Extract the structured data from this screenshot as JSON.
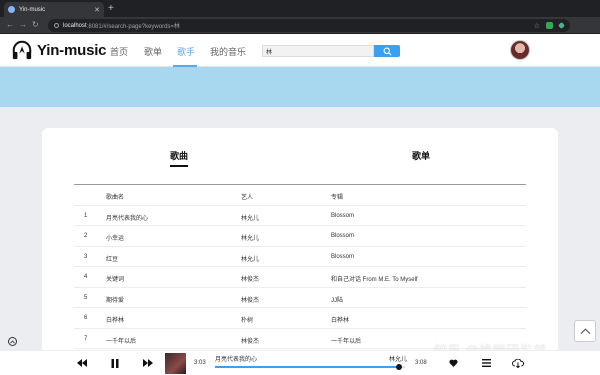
{
  "browser": {
    "tab_title": "Yin-music",
    "url_host": "localhost",
    "url_path": ":8081/#/search-page?keywords=林"
  },
  "app": {
    "logo_text": "Yin-music",
    "nav": [
      {
        "label": "首页",
        "active": false
      },
      {
        "label": "歌单",
        "active": false
      },
      {
        "label": "歌手",
        "active": true
      },
      {
        "label": "我的音乐",
        "active": false
      }
    ],
    "search_value": "林",
    "accent_color": "#3ba0f0"
  },
  "results": {
    "tabs": [
      "歌曲",
      "歌单"
    ],
    "active_tab": "歌曲",
    "columns": [
      "歌曲名",
      "艺人",
      "专辑"
    ],
    "rows": [
      {
        "idx": "1",
        "name": "月亮代表我的心",
        "artist": "林允儿",
        "album": "Blossom"
      },
      {
        "idx": "2",
        "name": "小幸运",
        "artist": "林允儿",
        "album": "Blossom"
      },
      {
        "idx": "3",
        "name": "红豆",
        "artist": "林允儿",
        "album": "Blossom"
      },
      {
        "idx": "4",
        "name": "关键词",
        "artist": "林俊杰",
        "album": "和自己对话 From M.E. To Myself"
      },
      {
        "idx": "5",
        "name": "期待爱",
        "artist": "林俊杰",
        "album": "JJ陆"
      },
      {
        "idx": "6",
        "name": "白桦林",
        "artist": "朴树",
        "album": "白桦林"
      },
      {
        "idx": "7",
        "name": "一千年以后",
        "artist": "林俊杰",
        "album": "一千年以后"
      }
    ]
  },
  "player": {
    "current_time": "3:03",
    "total_time": "3:08",
    "title": "月亮代表我的心",
    "artist": "林允儿",
    "progress": 0.97
  },
  "watermark": "知乎 @终端研发部"
}
